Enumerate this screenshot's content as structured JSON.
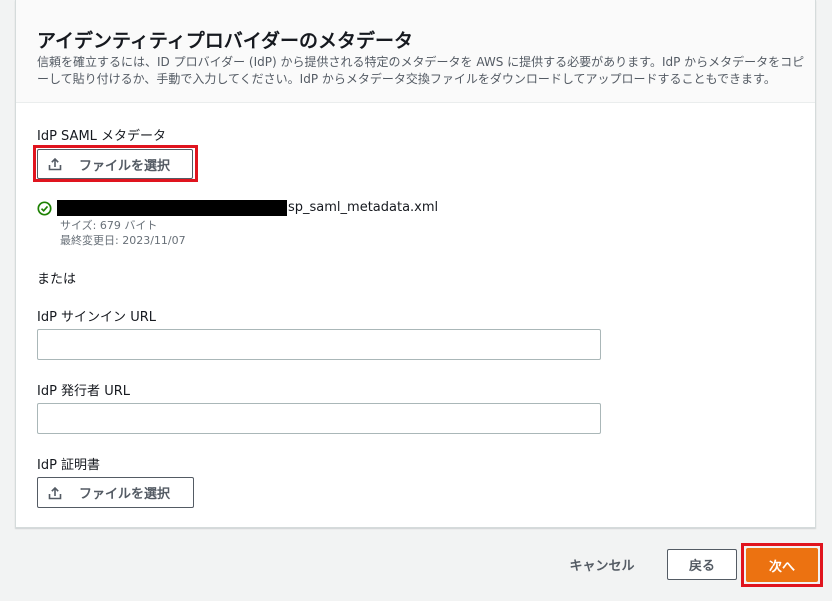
{
  "panel": {
    "title": "アイデンティティプロバイダーのメタデータ",
    "description": "信頼を確立するには、ID プロバイダー (IdP) から提供される特定のメタデータを AWS に提供する必要があります。IdP からメタデータをコピーして貼り付けるか、手動で入力してください。IdP からメタデータ交換ファイルをダウンロードしてアップロードすることもできます。"
  },
  "saml": {
    "label": "IdP SAML メタデータ",
    "choose_file_label": "ファイルを選択",
    "file": {
      "name_suffix": "sp_saml_metadata.xml",
      "size": "サイズ: 679 バイト",
      "modified": "最終変更日: 2023/11/07"
    }
  },
  "or_text": "または",
  "signin_url": {
    "label": "IdP サインイン URL",
    "value": "",
    "placeholder": ""
  },
  "issuer_url": {
    "label": "IdP 発行者 URL",
    "value": "",
    "placeholder": ""
  },
  "certificate": {
    "label": "IdP 証明書",
    "choose_file_label": "ファイルを選択"
  },
  "footer": {
    "cancel_label": "キャンセル",
    "back_label": "戻る",
    "next_label": "次へ"
  },
  "colors": {
    "primary_button": "#ec7211",
    "highlight": "#e0141e",
    "success": "#1d8102"
  },
  "icons": {
    "upload": "upload-icon",
    "success": "status-success-icon"
  }
}
